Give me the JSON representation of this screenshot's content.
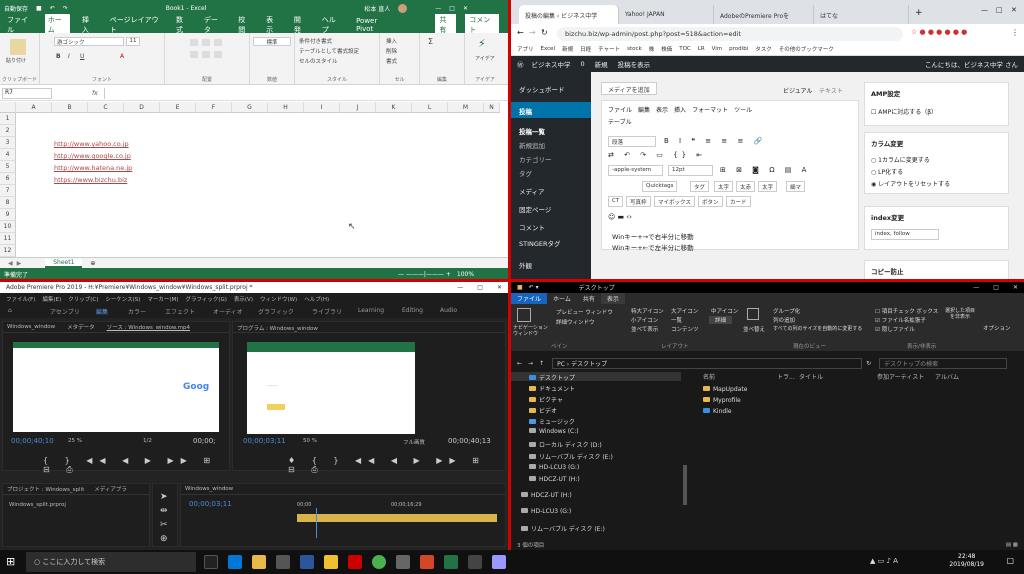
{
  "excel": {
    "title_left": "自動保存",
    "title_center": "Book1 - Excel",
    "user": "松本 直人",
    "tabs": [
      "ファイル",
      "ホーム",
      "挿入",
      "ページレイアウト",
      "数式",
      "データ",
      "校閲",
      "表示",
      "開発",
      "ヘルプ",
      "Power Pivot"
    ],
    "share": "共有",
    "comment": "コメント",
    "groups": [
      "クリップボード",
      "フォント",
      "配置",
      "数値",
      "スタイル",
      "セル",
      "編集",
      "アイデア"
    ],
    "font_name": "游ゴシック",
    "font_size": "11",
    "number_format": "標準",
    "style_items": [
      "条件付き書式",
      "テーブルとして書式設定",
      "セルのスタイル"
    ],
    "cell_items": [
      "挿入",
      "削除",
      "書式"
    ],
    "paste": "貼り付け",
    "ideas": "アイデア",
    "name_box": "R7",
    "fx": "fx",
    "columns": [
      "A",
      "B",
      "C",
      "D",
      "E",
      "F",
      "G",
      "H",
      "I",
      "J",
      "K",
      "L",
      "M",
      "N"
    ],
    "rows": [
      "1",
      "2",
      "3",
      "4",
      "5",
      "6",
      "7",
      "8",
      "9",
      "10",
      "11",
      "12"
    ],
    "links": [
      "http://www.yahoo.co.jp",
      "http://www.google.co.jp",
      "http://www.hatena.ne.jp",
      "https://www.bizchu.biz"
    ],
    "sheet": "Sheet1",
    "status": "準備完了",
    "zoom": "100%"
  },
  "chrome": {
    "tabs": [
      "投稿の編集 ‹ ビジネス中学",
      "Yahoo! JAPAN",
      "AdobeのPremiere Proを",
      "はてな"
    ],
    "url": "bizchu.biz/wp-admin/post.php?post=518&action=edit",
    "bookmarks": [
      "アプリ",
      "Excel",
      "新規",
      "日経",
      "チャート",
      "stock",
      "株",
      "株価",
      "TOC",
      "LR",
      "Vim",
      "prodibi",
      "タスク",
      "その他のブックマーク"
    ],
    "wp_bar": [
      "ビジネス中学",
      "0",
      "新規",
      "投稿を表示"
    ],
    "wp_greeting": "こんにちは、ビジネス中学 さん",
    "side": [
      "ダッシュボード",
      "投稿",
      "投稿一覧",
      "新規追加",
      "カテゴリー",
      "タグ",
      "メディア",
      "固定ページ",
      "コメント",
      "STINGERタグ",
      "外観"
    ],
    "media_btn": "メディアを追加",
    "visual": "ビジュアル",
    "text": "テキスト",
    "menu": [
      "ファイル",
      "編集",
      "表示",
      "挿入",
      "フォーマット",
      "ツール",
      "テーブル"
    ],
    "format": "段落",
    "font": "-apple-system",
    "size": "12pt",
    "quick": [
      "Quicktags",
      "タグ",
      "太字",
      "太赤",
      "太字",
      "細マ"
    ],
    "quick2": [
      "CT",
      "写真枠",
      "マイボックス",
      "ボタン",
      "カード"
    ],
    "body": [
      "Winキー+→で右半分に移動",
      "Winキー+←で左半分に移動"
    ],
    "amp_title": "AMP設定",
    "amp_label": "AMPに対応する（β）",
    "column_title": "カラム変更",
    "column_options": [
      "1カラムに変更する",
      "LP化する",
      "レイアウトをリセットする"
    ],
    "index_title": "index変更",
    "index_value": "index, follow",
    "copy_title": "コピー防止"
  },
  "premiere": {
    "title": "Adobe Premiere Pro 2019 - H:¥Premiere¥Windows_window¥Windows_split.prproj *",
    "menu": [
      "ファイル(F)",
      "編集(E)",
      "クリップ(C)",
      "シーケンス(S)",
      "マーカー(M)",
      "グラフィック(G)",
      "表示(V)",
      "ウィンドウ(W)",
      "ヘルプ(H)"
    ],
    "workspaces": [
      "アセンブリ",
      "編集",
      "カラー",
      "エフェクト",
      "オーディオ",
      "グラフィック",
      "ライブラリ",
      "Learning",
      "Editing",
      "Audio"
    ],
    "source_tabs": [
      "Windows_window",
      "メタデータ",
      "ソース : Windows_window.mp4"
    ],
    "program_tab": "プログラム : Windows_window",
    "src_tc": "00;00;40;10",
    "src_zoom": "25 %",
    "src_res": "1/2",
    "src_tc2": "00;00;",
    "prg_tc": "00;00;03;11",
    "prg_zoom": "50 %",
    "prg_fit": "フル画質",
    "prg_tc2": "00;00;40;13",
    "project_tab": "プロジェクト : Windows_split",
    "browser_tab": "メディアブラ",
    "project_file": "Windows_split.prproj",
    "timeline_tab": "Windows_window",
    "timeline_tc": "00;00;03;11",
    "ruler": [
      "00;00",
      "00;00;16;29"
    ]
  },
  "explorer": {
    "title": "デスクトップ",
    "tabs": [
      "ファイル",
      "ホーム",
      "共有",
      "表示"
    ],
    "ribbon": [
      "ナビゲーション ウィンドウ",
      "プレビュー ウィンドウ",
      "詳細ウィンドウ",
      "特大アイコン",
      "大アイコン",
      "中アイコン",
      "小アイコン",
      "一覧",
      "詳細",
      "並べて表示",
      "コンテンツ",
      "並べ替え",
      "グループ化",
      "列の追加",
      "すべての列のサイズを自動的に変更する",
      "項目チェック ボックス",
      "ファイル名拡張子",
      "隠しファイル",
      "選択した項目を非表示",
      "オプション"
    ],
    "ribbon_groups": [
      "ペイン",
      "レイアウト",
      "現在のビュー",
      "表示/非表示"
    ],
    "path": "PC › デスクトップ",
    "search": "デスクトップの検索",
    "tree": [
      "デスクトップ",
      "ドキュメント",
      "ピクチャ",
      "ビデオ",
      "ミュージック",
      "Windows (C:)",
      "ローカル ディスク (D:)",
      "リムーバブル ディスク (E:)",
      "HD-LCU3 (G:)",
      "HDCZ-UT (H:)",
      "HDCZ-UT (H:)",
      "HD-LCU3 (G:)",
      "リムーバブル ディスク (E:)"
    ],
    "headers": [
      "名前",
      "トラ...",
      "タイトル",
      "参加アーティスト",
      "アルバム"
    ],
    "files": [
      "MapUpdate",
      "Myprofile",
      "Kindle"
    ],
    "status": "3 個の項目"
  },
  "taskbar": {
    "search": "ここに入力して検索",
    "time": "22:48",
    "date": "2019/08/19"
  }
}
